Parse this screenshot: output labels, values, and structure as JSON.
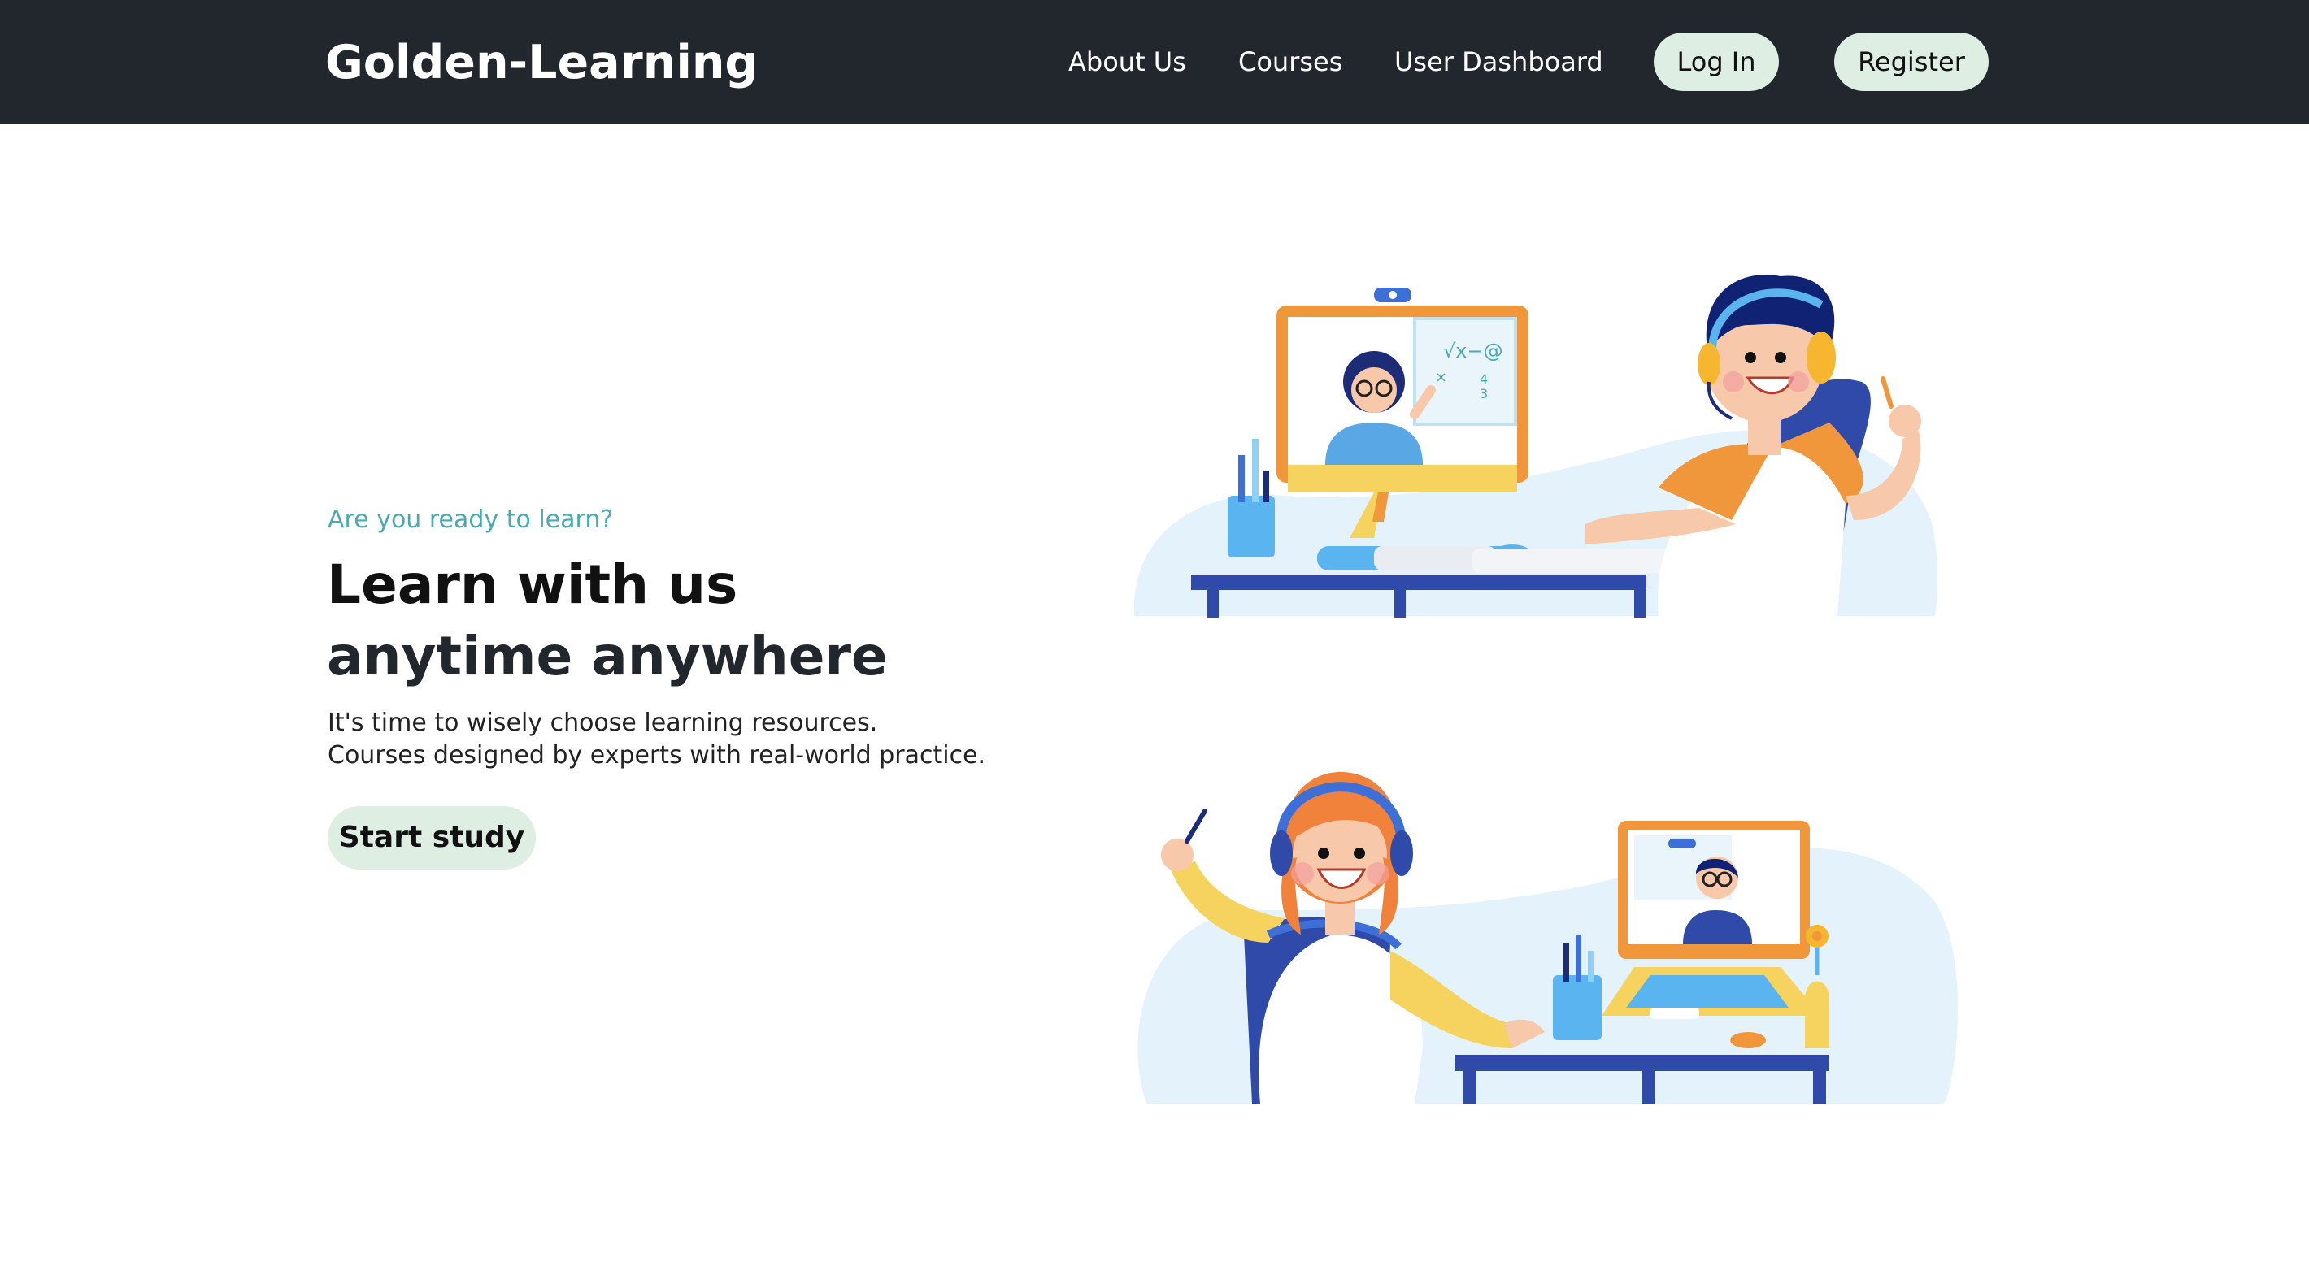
{
  "nav": {
    "brand": "Golden-Learning",
    "links": [
      "About Us",
      "Courses",
      "User Dashboard"
    ],
    "login_label": "Log In",
    "register_label": "Register"
  },
  "hero": {
    "eyebrow": "Are you ready to learn?",
    "headline_line1": "Learn with us",
    "headline_line2": "anytime anywhere",
    "description_line1": "It's time to wisely choose learning resources.",
    "description_line2": "Courses designed by experts with real-world practice.",
    "cta_label": "Start study"
  },
  "illustrations": {
    "top": {
      "board_text": "√x−@",
      "board_frac_top": "4",
      "board_frac_bottom": "3",
      "board_symbol": "×"
    }
  },
  "colors": {
    "navbar_bg": "#22262d",
    "button_bg": "#dfeee3",
    "accent_teal": "#4aa9b3",
    "desk_blue": "#2f4aa8",
    "orange": "#f0963b",
    "yellow": "#f6d25f",
    "light_blue_blob": "#e4f2fb"
  }
}
